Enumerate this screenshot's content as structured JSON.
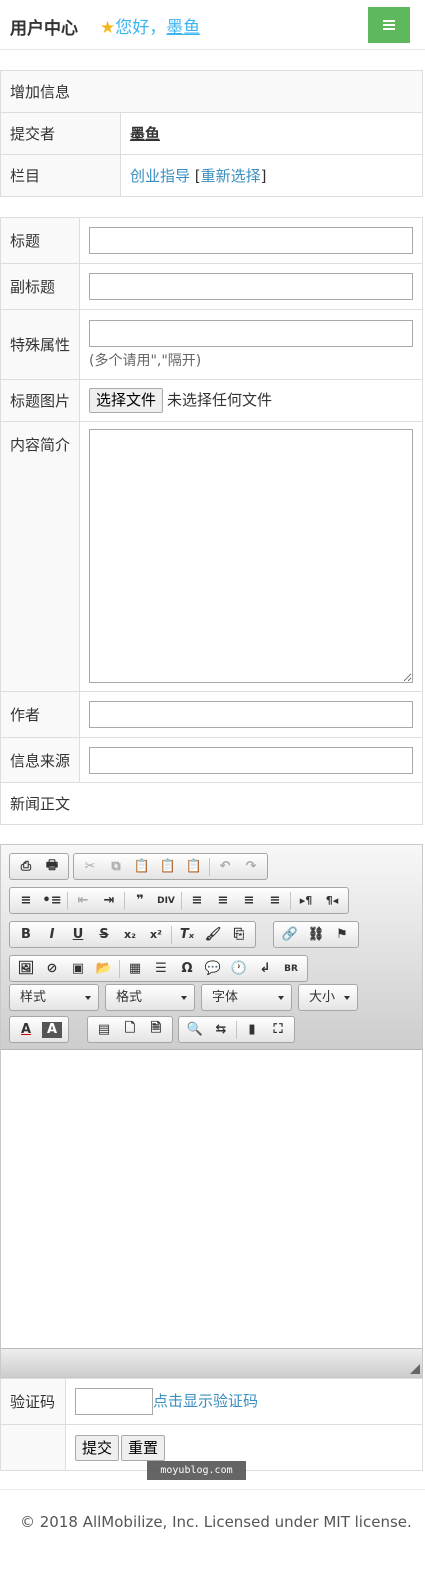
{
  "header": {
    "title": "用户中心",
    "greeting": "您好，",
    "username": "墨鱼",
    "star": "★"
  },
  "info_table": {
    "heading": "增加信息",
    "submitter_label": "提交者",
    "submitter_value": "墨鱼",
    "column_label": "栏目",
    "column_value": "创业指导",
    "reselect_open": " [",
    "reselect_link": "重新选择",
    "reselect_close": "]"
  },
  "form": {
    "title_label": "标题",
    "subtitle_label": "副标题",
    "special_label": "特殊属性",
    "special_hint": "(多个请用\",\"隔开)",
    "image_label": "标题图片",
    "file_button": "选择文件",
    "file_status": "未选择任何文件",
    "intro_label": "内容简介",
    "author_label": "作者",
    "source_label": "信息来源",
    "body_label": "新闻正文"
  },
  "editor": {
    "combos": [
      "样式",
      "格式",
      "字体",
      "大小"
    ],
    "buttons": {
      "preview": "⎙",
      "print": "🖶",
      "cut": "✂",
      "copy": "⧉",
      "paste": "📋",
      "paste_text": "📋",
      "paste_word": "📋",
      "undo": "↶",
      "redo": "↷",
      "ol": "≡",
      "ul": "•≡",
      "outdent": "⇤",
      "indent": "⇥",
      "quote": "❞",
      "div": "DIV",
      "align_left": "≡",
      "align_center": "≡",
      "align_right": "≡",
      "justify": "≡",
      "ltr": "▸¶",
      "rtl": "¶◂",
      "bold": "B",
      "italic": "I",
      "underline": "U",
      "strike": "S",
      "sub": "x₂",
      "sup": "x²",
      "clear": "Tₓ",
      "brush": "🖌",
      "copyfmt": "⎘",
      "link": "🔗",
      "unlink": "⛓",
      "anchor": "⚑",
      "image": "🖼",
      "flash": "⊘",
      "media": "▣",
      "file": "📂",
      "table": "▦",
      "hr": "☰",
      "omega": "Ω",
      "smiley": "💬",
      "clock": "🕐",
      "pagebreak": "↲",
      "br": "BR",
      "fontcolor": "A",
      "bgcolor": "A",
      "templates": "▤",
      "newdoc": "🗋",
      "doc": "🗎",
      "find": "🔍",
      "replace": "⇆",
      "source": "▮",
      "maximize": "⛶"
    }
  },
  "verify": {
    "label": "验证码",
    "link": "点击显示验证码",
    "submit": "提交",
    "reset": "重置"
  },
  "watermark": "moyublog.com",
  "footer": "© 2018 AllMobilize, Inc. Licensed under MIT license.",
  "colors": {
    "accent_green": "#5eb95e",
    "link_blue": "#3a8fc0",
    "greet_blue": "#3bb4f2",
    "star_yellow": "#f5b71f"
  }
}
